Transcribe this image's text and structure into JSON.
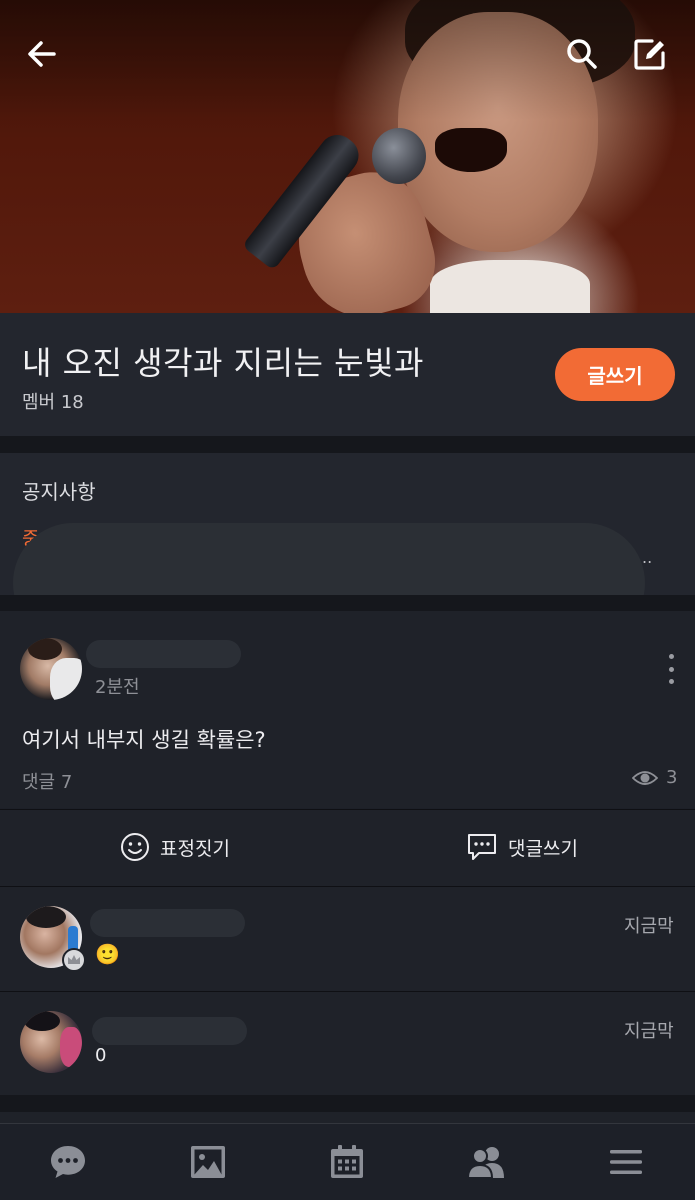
{
  "header": {
    "title": "내 오진 생각과 지리는 눈빛과",
    "member_count": "멤버 18",
    "write_button": "글쓰기"
  },
  "top_bar": {
    "icons": [
      "arrow-left-icon",
      "search-icon",
      "compose-icon"
    ]
  },
  "notice": {
    "label": "공지사항",
    "peek_text": "중",
    "ellipsis": ".."
  },
  "post": {
    "time": "2분전",
    "text": "여기서 내부지 생길 확률은?",
    "comments": "댓글 7",
    "views": "3"
  },
  "actions": {
    "react_label": "표정짓기",
    "comment_label": "댓글쓰기"
  },
  "comments": [
    {
      "time": "지금막",
      "text": "🙂"
    },
    {
      "time": "지금막",
      "text": "0"
    }
  ],
  "bottom_nav": {
    "items": [
      "chat-icon",
      "photo-icon",
      "calendar-icon",
      "members-icon",
      "menu-icon"
    ]
  },
  "colors": {
    "accent": "#f26b35",
    "background": "#1d2028",
    "card": "#1f2229"
  }
}
